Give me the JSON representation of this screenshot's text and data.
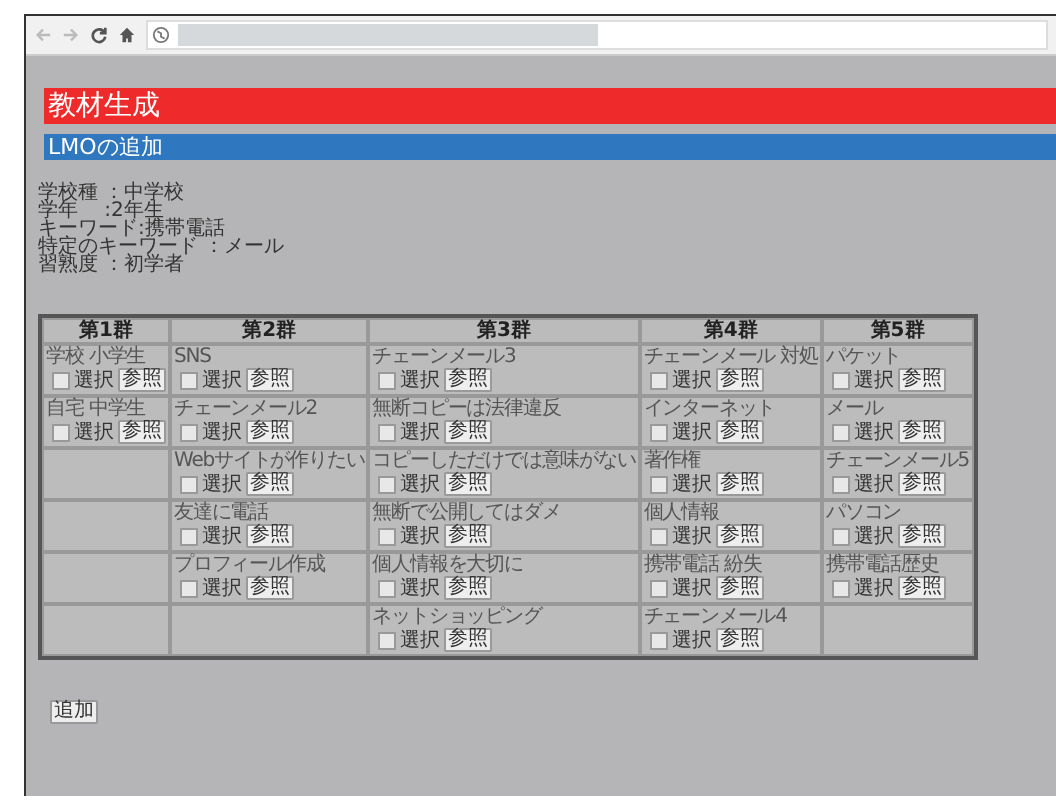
{
  "title": "教材生成",
  "subtitle": "LMOの追加",
  "info": [
    "学校種 ：中学校",
    "学年 　:2年生",
    "キーワード:携帯電話",
    "特定のキーワード ：メール",
    "習熟度 ：初学者"
  ],
  "table": {
    "columns": [
      "第1群",
      "第2群",
      "第3群",
      "第4群",
      "第5群"
    ],
    "rows": [
      [
        {
          "kind": "item",
          "label": "学校 小学生",
          "checked": false,
          "select_label": "選択",
          "button": "参照"
        },
        {
          "kind": "item",
          "label": "SNS",
          "checked": false,
          "select_label": "選択",
          "button": "参照"
        },
        {
          "kind": "item",
          "label": "チェーンメール3",
          "checked": false,
          "select_label": "選択",
          "button": "参照"
        },
        {
          "kind": "item",
          "label": "チェーンメール 対処",
          "checked": false,
          "select_label": "選択",
          "button": "参照"
        },
        {
          "kind": "item",
          "label": "パケット",
          "checked": false,
          "select_label": "選択",
          "button": "参照"
        }
      ],
      [
        {
          "kind": "item",
          "label": "自宅 中学生",
          "checked": false,
          "select_label": "選択",
          "button": "参照"
        },
        {
          "kind": "item",
          "label": "チェーンメール2",
          "checked": false,
          "select_label": "選択",
          "button": "参照"
        },
        {
          "kind": "item",
          "label": "無断コピーは法律違反",
          "checked": false,
          "select_label": "選択",
          "button": "参照"
        },
        {
          "kind": "item",
          "label": "インターネット",
          "checked": false,
          "select_label": "選択",
          "button": "参照"
        },
        {
          "kind": "item",
          "label": "メール",
          "checked": false,
          "select_label": "選択",
          "button": "参照"
        }
      ],
      [
        {
          "kind": "empty"
        },
        {
          "kind": "item",
          "label": "Webサイトが作りたい",
          "checked": false,
          "select_label": "選択",
          "button": "参照"
        },
        {
          "kind": "item",
          "label": "コピーしただけでは意味がない",
          "checked": false,
          "select_label": "選択",
          "button": "参照"
        },
        {
          "kind": "item",
          "label": "著作権",
          "checked": false,
          "select_label": "選択",
          "button": "参照"
        },
        {
          "kind": "item",
          "label": "チェーンメール5",
          "checked": false,
          "select_label": "選択",
          "button": "参照"
        }
      ],
      [
        {
          "kind": "empty"
        },
        {
          "kind": "item",
          "label": "友達に電話",
          "checked": false,
          "select_label": "選択",
          "button": "参照"
        },
        {
          "kind": "item",
          "label": "無断で公開してはダメ",
          "checked": false,
          "select_label": "選択",
          "button": "参照"
        },
        {
          "kind": "item",
          "label": "個人情報",
          "checked": false,
          "select_label": "選択",
          "button": "参照"
        },
        {
          "kind": "item",
          "label": "パソコン",
          "checked": false,
          "select_label": "選択",
          "button": "参照"
        }
      ],
      [
        {
          "kind": "empty"
        },
        {
          "kind": "item",
          "label": "プロフィール作成",
          "checked": false,
          "select_label": "選択",
          "button": "参照"
        },
        {
          "kind": "item",
          "label": "個人情報を大切に",
          "checked": false,
          "select_label": "選択",
          "button": "参照"
        },
        {
          "kind": "item",
          "label": "携帯電話 紛失",
          "checked": false,
          "select_label": "選択",
          "button": "参照"
        },
        {
          "kind": "item",
          "label": "携帯電話歴史",
          "checked": false,
          "select_label": "選択",
          "button": "参照"
        }
      ],
      [
        {
          "kind": "empty"
        },
        {
          "kind": "empty"
        },
        {
          "kind": "item",
          "label": "ネットショッピング",
          "checked": false,
          "select_label": "選択",
          "button": "参照"
        },
        {
          "kind": "item",
          "label": "チェーンメール4",
          "checked": false,
          "select_label": "選択",
          "button": "参照"
        },
        {
          "kind": "empty"
        }
      ]
    ]
  },
  "add_button": "追加"
}
